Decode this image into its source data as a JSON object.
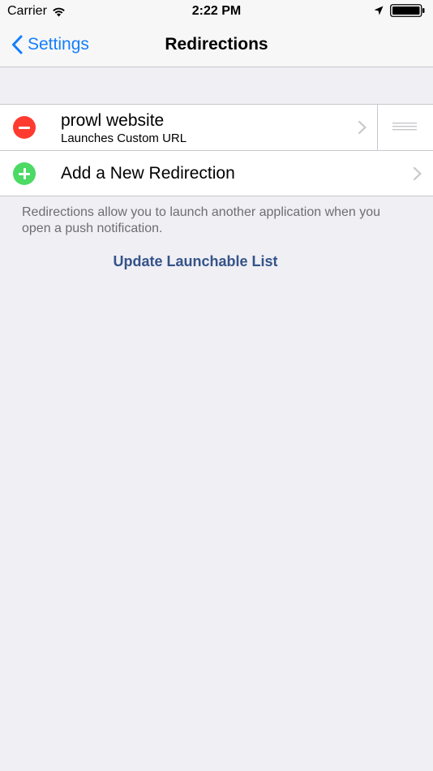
{
  "status_bar": {
    "carrier": "Carrier",
    "time": "2:22 PM"
  },
  "nav": {
    "back_label": "Settings",
    "title": "Redirections"
  },
  "redirections": [
    {
      "title": "prowl website",
      "subtitle": "Launches Custom URL"
    }
  ],
  "add_row": {
    "label": "Add a New Redirection"
  },
  "footer": {
    "description": "Redirections allow you to launch another application when you open a push notification.",
    "update_link": "Update Launchable List"
  },
  "colors": {
    "tint": "#147efb",
    "delete": "#ff3b30",
    "add": "#4cd964",
    "link": "#355389",
    "background": "#efeff4"
  },
  "icons": {
    "wifi": "wifi-icon",
    "location": "location-arrow-icon",
    "battery": "battery-icon",
    "back": "chevron-left-icon",
    "disclosure": "chevron-right-icon",
    "delete": "minus-circle-icon",
    "add": "plus-circle-icon",
    "reorder": "reorder-handle-icon"
  }
}
